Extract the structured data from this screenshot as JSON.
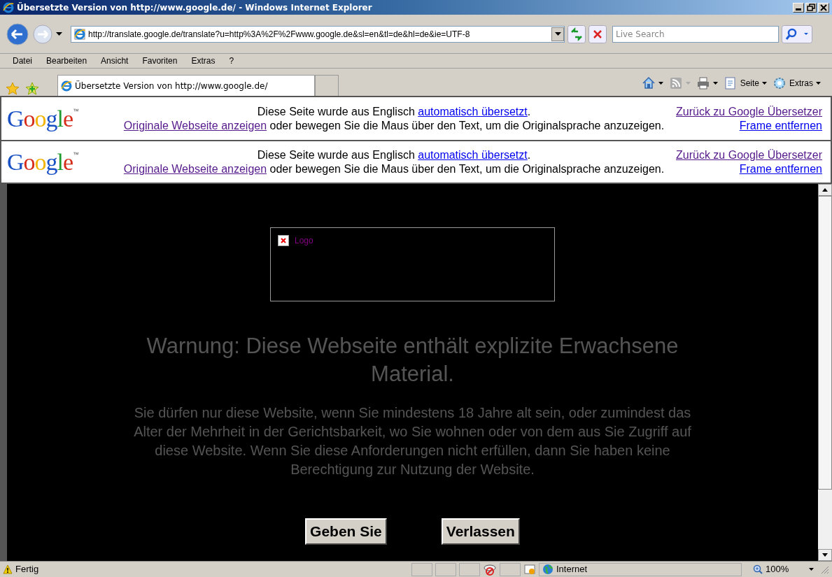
{
  "window": {
    "title": "Übersetzte Version von http://www.google.de/ - Windows Internet Explorer"
  },
  "address_bar": {
    "url": "http://translate.google.de/translate?u=http%3A%2F%2Fwww.google.de&sl=en&tl=de&hl=de&ie=UTF-8"
  },
  "search": {
    "placeholder": "Live Search"
  },
  "menu": [
    "Datei",
    "Bearbeiten",
    "Ansicht",
    "Favoriten",
    "Extras",
    "?"
  ],
  "tab": {
    "title": "Übersetzte Version von http://www.google.de/"
  },
  "command_bar": [
    {
      "kind": "home"
    },
    {
      "kind": "feeds"
    },
    {
      "kind": "print"
    },
    {
      "kind": "page",
      "label": "Seite"
    },
    {
      "kind": "tools",
      "label": "Extras"
    }
  ],
  "translate_bars": [
    {
      "logo": "Google",
      "tm": "™",
      "text_before": "Diese Seite wurde aus Englisch",
      "link": {
        "label": "automatisch übersetzt",
        "visited": false
      },
      "text_after": ".",
      "original_link": {
        "label": "Originale Webseite anzeigen",
        "visited": true
      },
      "hint": "oder bewegen Sie die Maus über den Text, um die Originalsprache anzuzeigen.",
      "back_link": {
        "label": "Zurück zu Google Übersetzer",
        "visited": true
      },
      "remove_link": {
        "label": "Frame entfernen",
        "visited": false
      }
    },
    {
      "logo": "Google",
      "tm": "™",
      "text_before": "Diese Seite wurde aus Englisch",
      "link": {
        "label": "automatisch übersetzt",
        "visited": false
      },
      "text_after": ".",
      "original_link": {
        "label": "Originale Webseite anzeigen",
        "visited": true
      },
      "hint": "oder bewegen Sie die Maus über den Text, um die Originalsprache anzuzeigen.",
      "back_link": {
        "label": "Zurück zu Google Übersetzer",
        "visited": true
      },
      "remove_link": {
        "label": "Frame entfernen",
        "visited": false
      }
    }
  ],
  "page": {
    "broken_image_alt": "Logo",
    "heading": "Warnung: Diese Webseite enthält explizite Erwachsene Material.",
    "body": "Sie dürfen nur diese Website, wenn Sie mindestens 18 Jahre alt sein, oder zumindest das Alter der Mehrheit in der Gerichtsbarkeit, wo Sie wohnen oder von dem aus Sie Zugriff auf diese Website.  Wenn Sie diese Anforderungen nicht erfüllen, dann Sie haben keine Berechtigung zur Nutzung der Website.",
    "buttons": [
      "Geben Sie",
      "Verlassen"
    ]
  },
  "status_bar": {
    "text": "Fertig",
    "zone": "Internet",
    "zoom": "100%"
  }
}
